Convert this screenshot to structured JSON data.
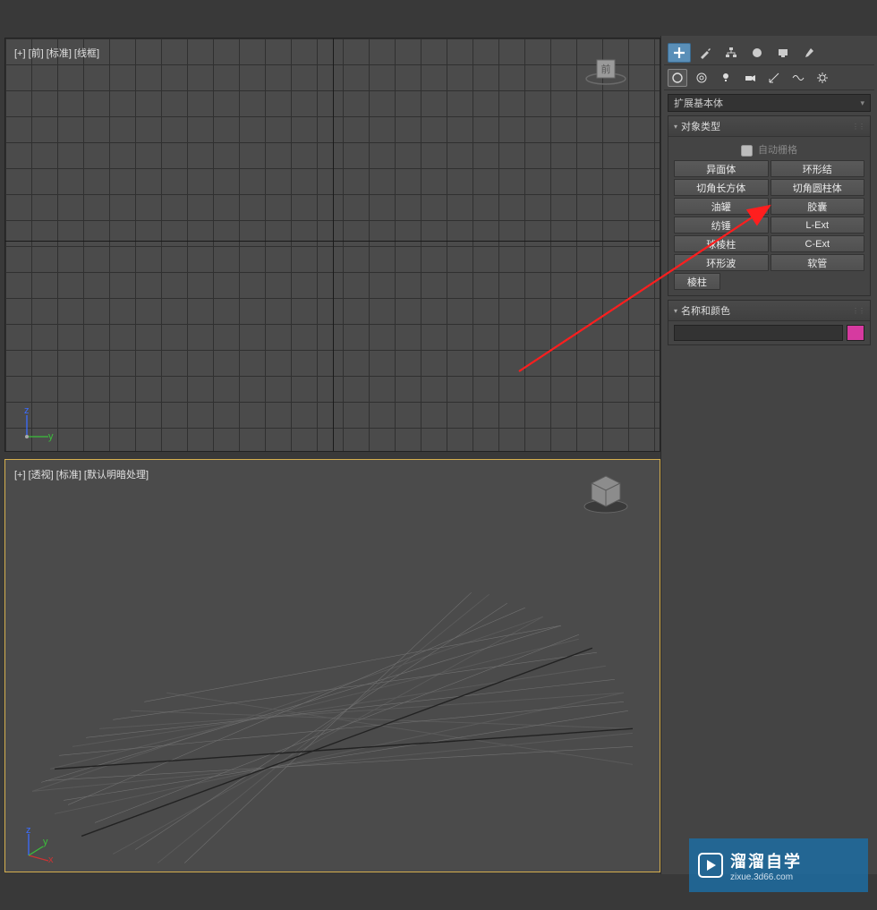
{
  "viewports": {
    "front": {
      "label": "[+] [前] [标准] [线框]"
    },
    "persp": {
      "label": "[+] [透视] [标准] [默认明暗处理]"
    }
  },
  "panel": {
    "dropdown": "扩展基本体",
    "rollouts": {
      "objectType": {
        "title": "对象类型",
        "autogrid": "自动栅格",
        "buttons": [
          "异面体",
          "环形结",
          "切角长方体",
          "切角圆柱体",
          "油罐",
          "胶囊",
          "纺锤",
          "L-Ext",
          "球棱柱",
          "C-Ext",
          "环形波",
          "软管",
          "棱柱"
        ]
      },
      "nameColor": {
        "title": "名称和颜色"
      }
    }
  },
  "watermark": {
    "title": "溜溜自学",
    "url": "zixue.3d66.com"
  }
}
